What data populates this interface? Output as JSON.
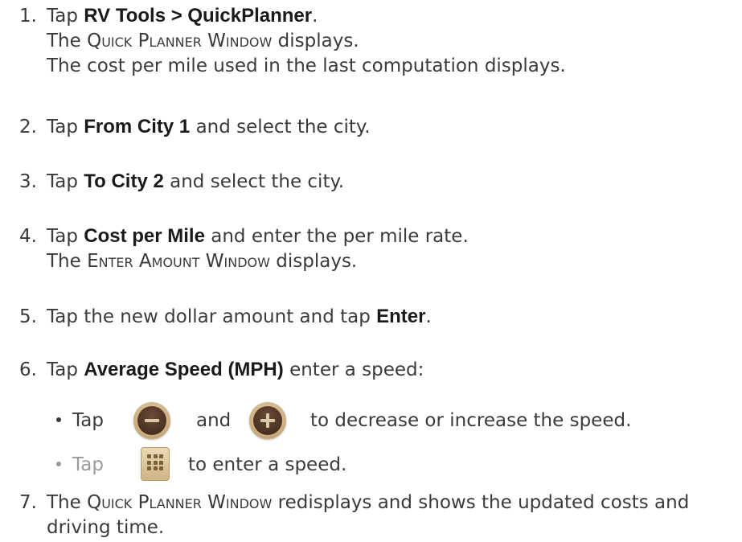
{
  "steps": [
    {
      "num": "1.",
      "pre": "Tap ",
      "bold": "RV Tools > QuickPlanner",
      "post": ".",
      "sub1_sc": "Quick Planner Window",
      "sub1_rest": " displays.",
      "sub2": "The cost per mile used in the last computation displays.",
      "sub1_the": "The "
    },
    {
      "num": "2.",
      "pre": "Tap ",
      "bold": "From City 1",
      "post": " and select the city."
    },
    {
      "num": "3.",
      "pre": "Tap ",
      "bold": "To City 2",
      "post": " and select the city."
    },
    {
      "num": "4.",
      "pre": "Tap ",
      "bold": "Cost per Mile",
      "post": " and enter the per mile rate.",
      "sub_the": "The ",
      "sub_sc": "Enter Amount Window",
      "sub_rest": " displays."
    },
    {
      "num": "5.",
      "pre": "Tap the new dollar amount and tap ",
      "bold": "Enter",
      "post": "."
    },
    {
      "num": "6.",
      "pre": "Tap ",
      "bold": "Average Speed (MPH)",
      "post": " enter a speed:"
    },
    {
      "num": "7.",
      "pre": "The ",
      "sc": "Quick Planner Window",
      "post": " redisplays and shows the updated costs and",
      "line2": "driving time."
    }
  ],
  "bullets": [
    {
      "tap": "Tap",
      "and": "and",
      "rest": "to decrease or increase the speed.",
      "icon1": "minus-icon",
      "icon2": "plus-icon"
    },
    {
      "tap": "Tap",
      "rest": "to enter a speed.",
      "icon": "keypad-icon"
    }
  ]
}
